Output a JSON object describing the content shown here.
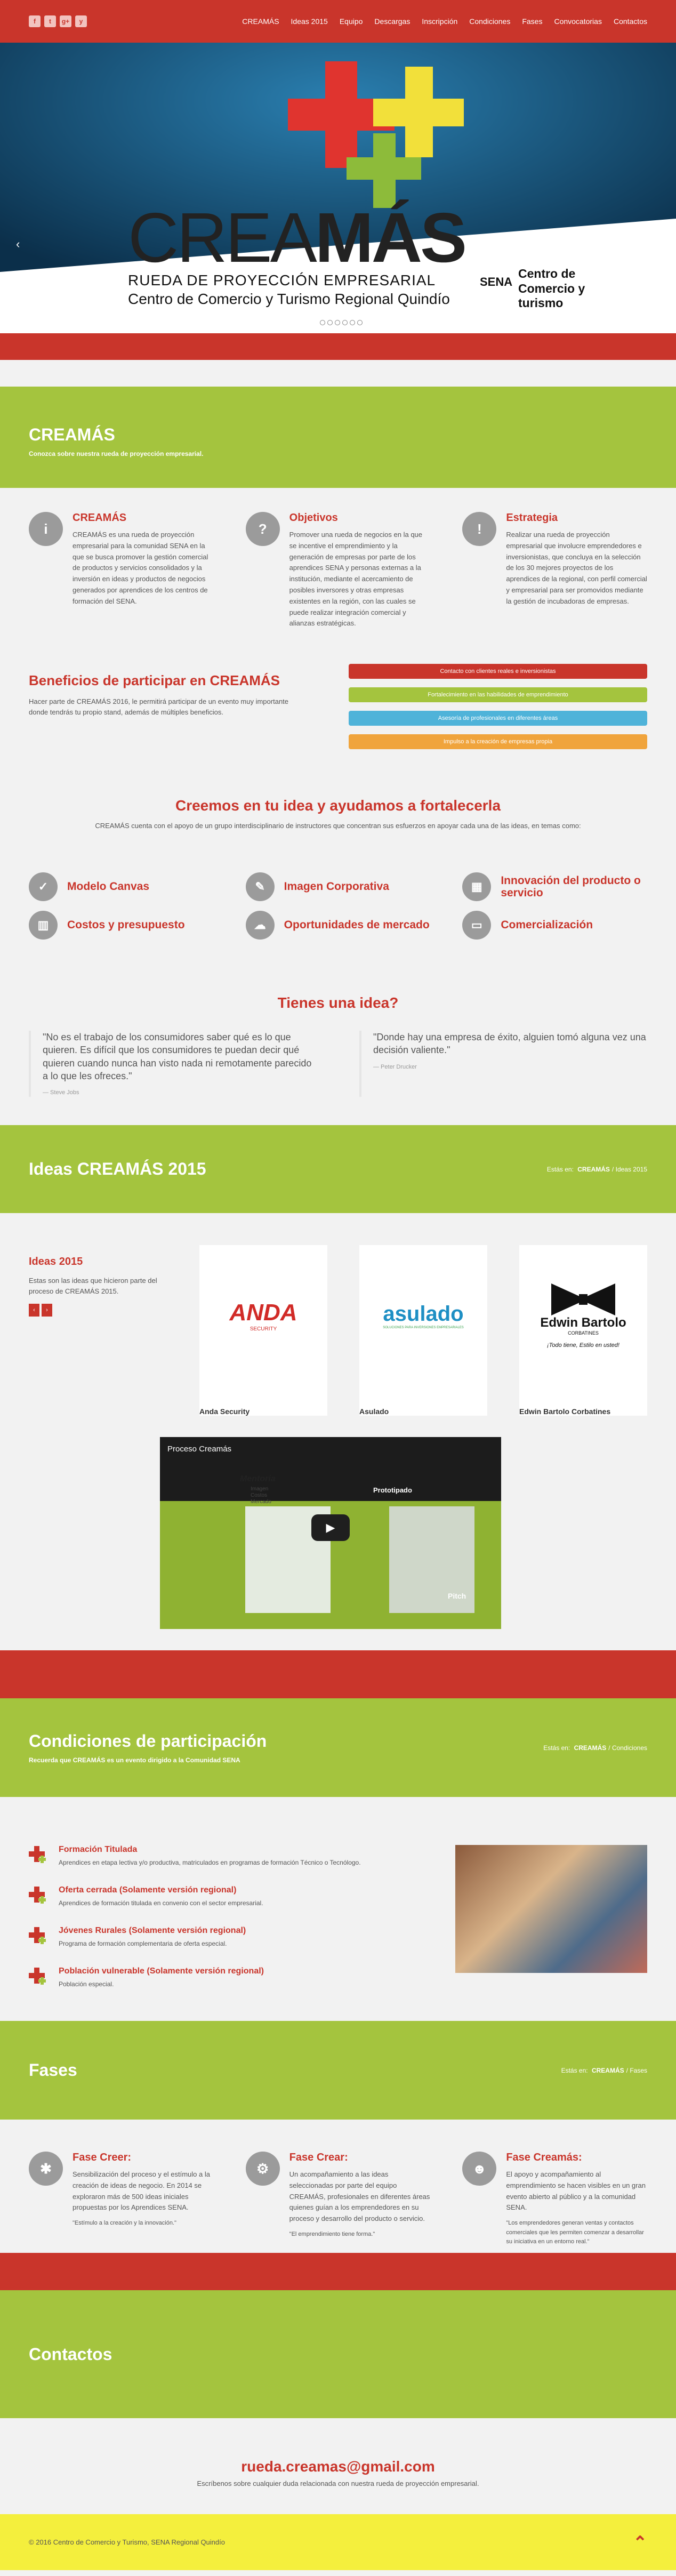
{
  "nav": {
    "social": [
      "f",
      "t",
      "g+",
      "y"
    ],
    "menu": [
      "CREAMÁS",
      "Ideas 2015",
      "Equipo",
      "Descargas",
      "Inscripción",
      "Condiciones",
      "Fases",
      "Convocatorias",
      "Contactos"
    ]
  },
  "hero": {
    "logo_light": "CREA",
    "logo_bold": "MÁS",
    "tagline1": "RUEDA DE PROYECCIÓN EMPRESARIAL",
    "tagline2": "Centro de Comercio y Turismo Regional Quindío",
    "sena_logo": "SENA",
    "sena_text": "Centro de Comercio y turismo",
    "prev": "‹",
    "next": "›",
    "slides": 6
  },
  "intro": {
    "title": "CREAMÁS",
    "subtitle": "Conozca sobre nuestra rueda de proyección empresarial."
  },
  "features": [
    {
      "icon": "info-icon",
      "glyph": "i",
      "title": "CREAMÁS",
      "text": "CREAMÁS es una rueda de proyección empresarial para la comunidad SENA en la que se busca promover la gestión comercial de productos y servicios consolidados y la inversión en ideas y productos de negocios generados por aprendices de los centros de formación del SENA."
    },
    {
      "icon": "question-icon",
      "glyph": "?",
      "title": "Objetivos",
      "text": "Promover una rueda de negocios en la que se incentive el emprendimiento y la generación de empresas por parte de los aprendices SENA y personas externas a la institución, mediante el acercamiento de posibles inversores y otras empresas existentes en la región, con las cuales se puede realizar integración comercial y alianzas estratégicas."
    },
    {
      "icon": "exclamation-icon",
      "glyph": "!",
      "title": "Estrategia",
      "text": "Realizar una rueda de proyección empresarial que involucre emprendedores e inversionistas, que concluya en la selección de los 30 mejores proyectos de los aprendices de la regional, con perfil comercial y empresarial para ser promovidos mediante la gestión de incubadoras de empresas."
    }
  ],
  "benefits": {
    "title": "Beneficios de participar en CREAMÁS",
    "text": "Hacer parte de CREAMÁS 2016, le permitirá participar de un evento muy importante donde tendrás tu propio stand, además de múltiples beneficios.",
    "bars": [
      {
        "label": "Contacto con clientes reales e inversionistas",
        "color": "#c9352b"
      },
      {
        "label": "Fortalecimiento en las habilidades de emprendimiento",
        "color": "#a4c43e"
      },
      {
        "label": "Asesoría de profesionales en diferentes áreas",
        "color": "#4fb3d9"
      },
      {
        "label": "Impulso a la creación de empresas propia",
        "color": "#f0a43c"
      }
    ]
  },
  "support": {
    "title": "Creemos en tu idea y ayudamos a fortalecerla",
    "text": "CREAMÁS cuenta con el apoyo de un grupo interdisciplinario de instructores que concentran sus esfuerzos en apoyar cada una de las ideas, en temas como:",
    "items": [
      {
        "icon": "checkbox-icon",
        "glyph": "✓",
        "label": "Modelo Canvas"
      },
      {
        "icon": "pencil-icon",
        "glyph": "✎",
        "label": "Imagen Corporativa"
      },
      {
        "icon": "grid-icon",
        "glyph": "▦",
        "label": "Innovación del producto o servicio"
      },
      {
        "icon": "chart-icon",
        "glyph": "▥",
        "label": "Costos y presupuesto"
      },
      {
        "icon": "cloud-icon",
        "glyph": "☁",
        "label": "Oportunidades de mercado"
      },
      {
        "icon": "card-icon",
        "glyph": "▭",
        "label": "Comercialización"
      }
    ]
  },
  "idea": {
    "title": "Tienes una idea?",
    "quotes": [
      {
        "text": "\"No es el trabajo de los consumidores saber qué es lo que quieren. Es difícil que los consumidores te puedan decir qué quieren cuando nunca han visto nada ni remotamente parecido a lo que les ofreces.\"",
        "author": "— Steve Jobs"
      },
      {
        "text": "\"Donde hay una empresa de éxito, alguien tomó alguna vez una decisión valiente.\"",
        "author": "— Peter Drucker"
      }
    ]
  },
  "ideas2015": {
    "title": "Ideas CREAMÁS 2015",
    "crumb_pre": "Estás en:",
    "crumb_home": "CREAMÁS",
    "crumb_sep": "/",
    "crumb_cur": "Ideas 2015",
    "side_title": "Ideas 2015",
    "side_text": "Estas son las ideas que hicieron parte del proceso de CREAMÁS 2015.",
    "prev": "‹",
    "next": "›",
    "cards": [
      {
        "logo": "ANDA",
        "logo_sub": "SECURITY",
        "name": "Anda Security"
      },
      {
        "logo": "asulado",
        "logo_sub": "SOLUCIONES PARA INVERSIONES EMPRESARIALES",
        "name": "Asulado"
      },
      {
        "logo": "Edwin Bartolo",
        "logo_sub": "CORBATINES",
        "caption": "¡Todo tiene, Estilo en usted!",
        "name": "Edwin Bartolo Corbatines"
      }
    ]
  },
  "video": {
    "title": "Proceso Creamás",
    "labels": [
      "Mentoria",
      "Imagen",
      "Costos",
      "Mercado",
      "Prototipado",
      "Pitch"
    ],
    "play": "▶"
  },
  "conditions": {
    "title": "Condiciones de participación",
    "subtitle": "Recuerda que CREAMÁS es un evento dirigido a la Comunidad SENA",
    "crumb_pre": "Estás en:",
    "crumb_home": "CREAMÁS",
    "crumb_sep": "/",
    "crumb_cur": "Condiciones",
    "items": [
      {
        "title": "Formación Titulada",
        "text": "Aprendices en etapa lectiva y/o productiva, matriculados en programas de formación Técnico o Tecnólogo."
      },
      {
        "title": "Oferta cerrada (Solamente versión regional)",
        "text": "Aprendices de formación titulada en convenio con el sector empresarial."
      },
      {
        "title": "Jóvenes Rurales (Solamente versión regional)",
        "text": "Programa de formación complementaria de oferta especial."
      },
      {
        "title": "Población vulnerable (Solamente versión regional)",
        "text": "Población especial."
      }
    ]
  },
  "phases": {
    "title": "Fases",
    "crumb_pre": "Estás en:",
    "crumb_home": "CREAMÁS",
    "crumb_sep": "/",
    "crumb_cur": "Fases",
    "items": [
      {
        "icon": "lightbulb-icon",
        "glyph": "✱",
        "title": "Fase Creer:",
        "text": "Sensibilización del proceso y el estímulo a la creación de ideas de negocio. En 2014 se exploraron más de 500 ideas iniciales propuestas por los Aprendices SENA.",
        "quote": "\"Estímulo a la creación y la innovación.\""
      },
      {
        "icon": "gear-icon",
        "glyph": "⚙",
        "title": "Fase Crear:",
        "text": "Un acompañamiento a las ideas seleccionadas por parte del equipo CREAMÁS, profesionales en diferentes áreas quienes guían a los emprendedores en su proceso y desarrollo del producto o servicio.",
        "quote": "\"El emprendimiento tiene forma.\""
      },
      {
        "icon": "user-icon",
        "glyph": "☻",
        "title": "Fase Creamás:",
        "text": "El apoyo y acompañamiento al emprendimiento se hacen visibles en un gran evento abierto al público y a la comunidad SENA.",
        "quote": "\"Los emprendedores generan ventas y contactos comerciales que les permiten comenzar a desarrollar su iniciativa en un entorno real.\""
      }
    ]
  },
  "contact": {
    "title": "Contactos",
    "email": "rueda.creamas@gmail.com",
    "text": "Escríbenos sobre cualquier duda relacionada con nuestra rueda de proyección empresarial."
  },
  "footer": {
    "copy": "© 2016 Centro de Comercio y Turismo, SENA Regional Quindío",
    "top": "⌃"
  },
  "colors": {
    "red": "#c9352b",
    "green": "#a4c43e",
    "yellow": "#f4ef3d",
    "gray": "#9b9b9b"
  }
}
